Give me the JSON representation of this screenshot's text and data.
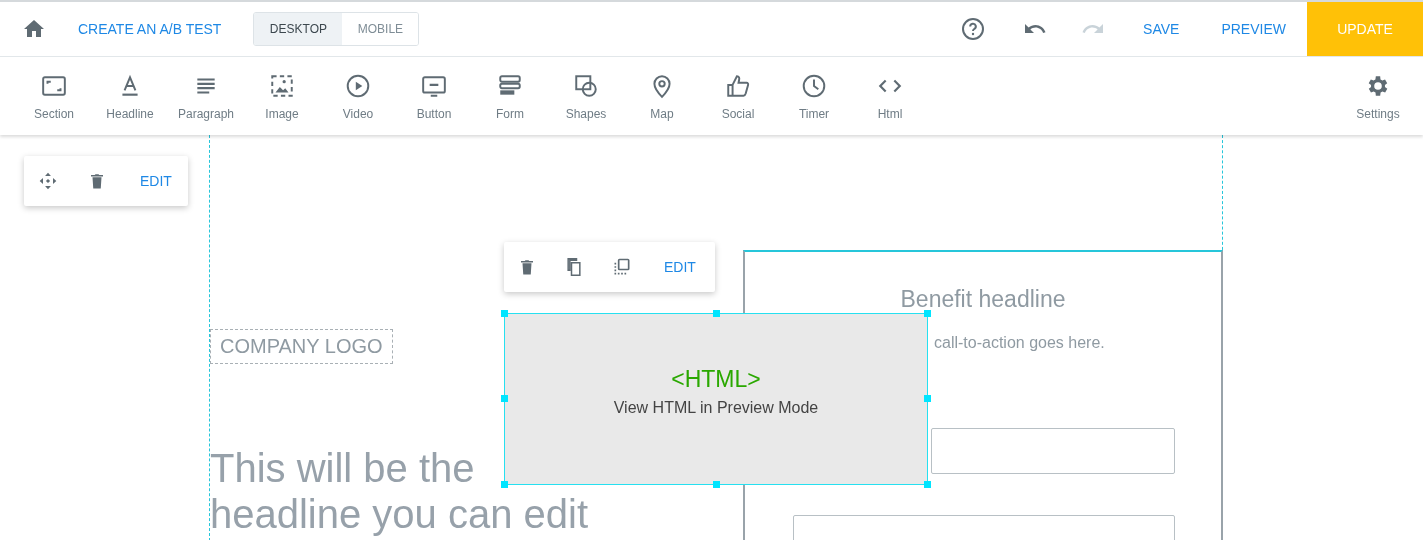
{
  "topbar": {
    "ab_test_link": "CREATE AN A/B TEST",
    "device_tabs": [
      {
        "label": "DESKTOP",
        "selected": true
      },
      {
        "label": "MOBILE",
        "selected": false
      }
    ],
    "undo": {
      "disabled": false
    },
    "redo": {
      "disabled": true
    },
    "save": "SAVE",
    "preview": "PREVIEW",
    "update": "UPDATE"
  },
  "toolbar": {
    "items": [
      {
        "kind": "section",
        "label": "Section"
      },
      {
        "kind": "headline",
        "label": "Headline"
      },
      {
        "kind": "paragraph",
        "label": "Paragraph"
      },
      {
        "kind": "image",
        "label": "Image"
      },
      {
        "kind": "video",
        "label": "Video"
      },
      {
        "kind": "button",
        "label": "Button"
      },
      {
        "kind": "form",
        "label": "Form"
      },
      {
        "kind": "shapes",
        "label": "Shapes"
      },
      {
        "kind": "map",
        "label": "Map"
      },
      {
        "kind": "social",
        "label": "Social"
      },
      {
        "kind": "timer",
        "label": "Timer"
      },
      {
        "kind": "html",
        "label": "Html"
      }
    ],
    "settings": "Settings"
  },
  "canvas": {
    "section_toolbar": {
      "edit": "EDIT"
    },
    "element_toolbar": {
      "edit": "EDIT"
    },
    "logo": "COMPANY LOGO",
    "headline": [
      "This will be the",
      "headline you can edit"
    ],
    "html_block": {
      "title": "<HTML>",
      "subtitle": "View HTML in Preview Mode",
      "selected": true
    },
    "form_card": {
      "headline": "Benefit headline",
      "text": "call-to-action goes here."
    }
  }
}
